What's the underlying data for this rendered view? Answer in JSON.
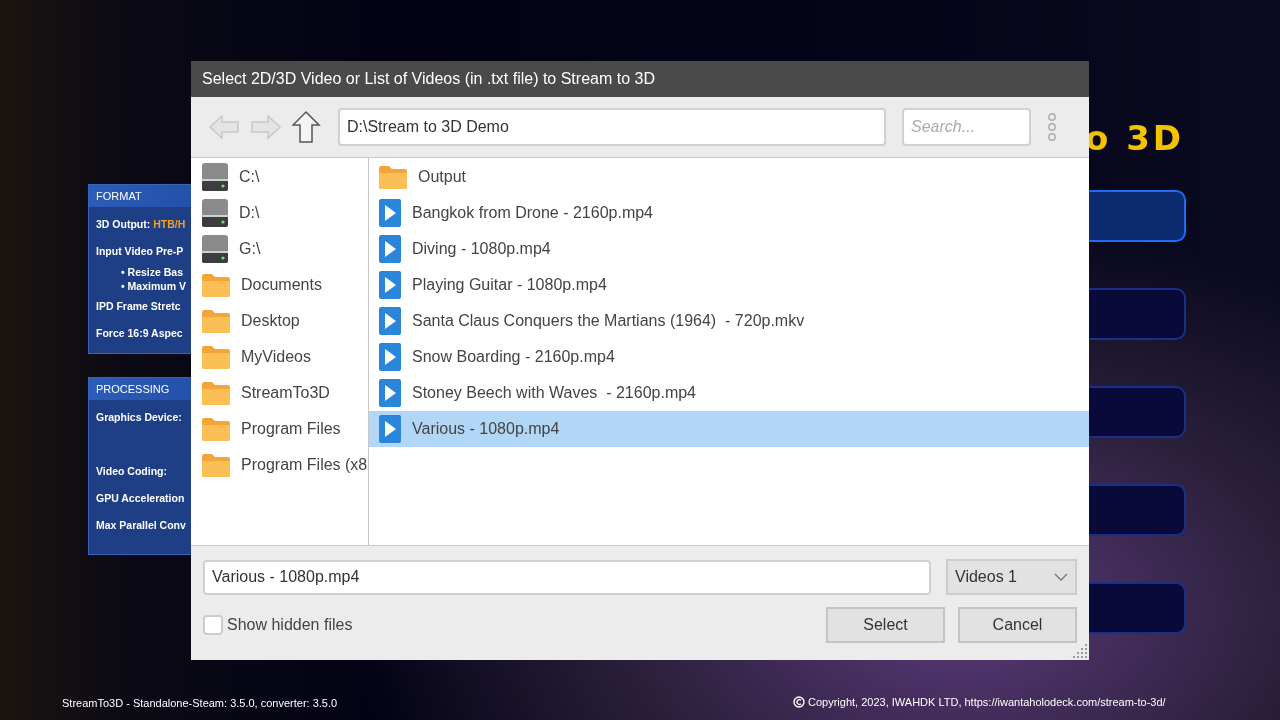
{
  "background": {
    "logo": "o 3D",
    "panels": [
      {
        "title": "FORMAT",
        "lines": [
          {
            "kind": "pair",
            "label": "3D Output: ",
            "value": "HTB/H"
          },
          {
            "kind": "text",
            "label": "Input Video Pre-P"
          },
          {
            "kind": "bullet",
            "label": "• Resize Bas"
          },
          {
            "kind": "bullet",
            "label": "• Maximum V"
          },
          {
            "kind": "text",
            "label": "IPD Frame Stretc"
          },
          {
            "kind": "text",
            "label": "Force 16:9 Aspec"
          }
        ]
      },
      {
        "title": "PROCESSING",
        "lines": [
          {
            "kind": "text",
            "label": "Graphics Device:"
          },
          {
            "kind": "gap"
          },
          {
            "kind": "text",
            "label": "Video Coding:"
          },
          {
            "kind": "text",
            "label": "GPU Acceleration"
          },
          {
            "kind": "text",
            "label": "Max Parallel Conv"
          }
        ]
      }
    ],
    "footer_left": "StreamTo3D - Standalone-Steam: 3.5.0, converter: 3.5.0",
    "footer_right": "Copyright, 2023, IWAHDK LTD, https://iwantaholodeck.com/stream-to-3d/"
  },
  "dialog": {
    "title": "Select 2D/3D Video or List of Videos (in .txt file) to Stream to 3D",
    "nav": [
      {
        "kind": "back",
        "disabled": true
      },
      {
        "kind": "forward",
        "disabled": true
      },
      {
        "kind": "up",
        "disabled": false
      }
    ],
    "path": "D:\\Stream to 3D Demo",
    "search": {
      "placeholder": "Search..."
    },
    "sidebar": [
      {
        "kind": "drive",
        "label": "C:\\"
      },
      {
        "kind": "drive",
        "label": "D:\\"
      },
      {
        "kind": "drive",
        "label": "G:\\"
      },
      {
        "kind": "folder",
        "label": "Documents"
      },
      {
        "kind": "folder",
        "label": "Desktop"
      },
      {
        "kind": "folder",
        "label": "MyVideos"
      },
      {
        "kind": "folder",
        "label": "StreamTo3D"
      },
      {
        "kind": "folder",
        "label": "Program Files"
      },
      {
        "kind": "folder",
        "label": "Program Files (x8"
      }
    ],
    "files": [
      {
        "kind": "folder",
        "label": "Output",
        "selected": false
      },
      {
        "kind": "video",
        "label": "Bangkok from Drone - 2160p.mp4",
        "selected": false
      },
      {
        "kind": "video",
        "label": "Diving - 1080p.mp4",
        "selected": false
      },
      {
        "kind": "video",
        "label": "Playing Guitar - 1080p.mp4",
        "selected": false
      },
      {
        "kind": "video",
        "label": "Santa Claus Conquers the Martians (1964)  - 720p.mkv",
        "selected": false
      },
      {
        "kind": "video",
        "label": "Snow Boarding - 2160p.mp4",
        "selected": false
      },
      {
        "kind": "video",
        "label": "Stoney Beech with Waves  - 2160p.mp4",
        "selected": false
      },
      {
        "kind": "video",
        "label": "Various - 1080p.mp4",
        "selected": true
      }
    ],
    "filename": "Various - 1080p.mp4",
    "filter": "Videos 1",
    "show_hidden": {
      "label": "Show hidden files",
      "checked": false
    },
    "buttons": [
      "Select",
      "Cancel"
    ]
  }
}
